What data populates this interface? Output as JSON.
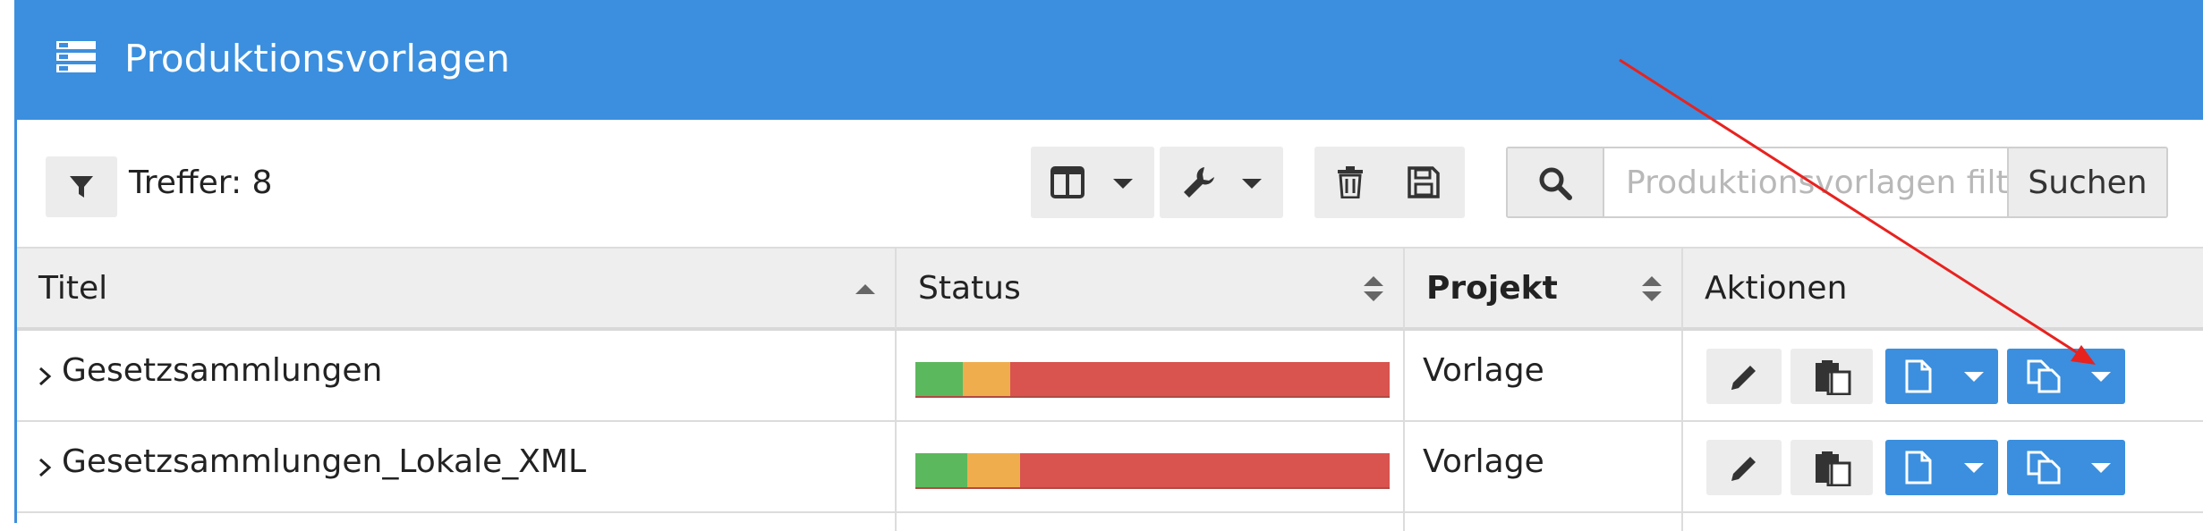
{
  "header": {
    "title": "Produktionsvorlagen",
    "icon": "list-icon"
  },
  "toolbar": {
    "hits_label": "Treffer: 8",
    "search": {
      "placeholder": "Produktionsvorlagen filtern",
      "button_label": "Suchen"
    }
  },
  "table": {
    "columns": [
      "Titel",
      "Status",
      "Projekt",
      "Aktionen"
    ],
    "sorted_column": "Titel",
    "rows": [
      {
        "title": "Gesetzsammlungen",
        "status": {
          "green": 0.1,
          "orange": 0.1,
          "red": 0.8
        },
        "project": "Vorlage"
      },
      {
        "title": "Gesetzsammlungen_Lokale_XML",
        "status": {
          "green": 0.11,
          "orange": 0.11,
          "red": 0.78
        },
        "project": "Vorlage"
      }
    ]
  },
  "colors": {
    "header_blue": "#3b8fde",
    "status_green": "#5cb85c",
    "status_orange": "#f0ad4e",
    "status_red": "#d9534f",
    "annotation_arrow": "#e8221f"
  }
}
